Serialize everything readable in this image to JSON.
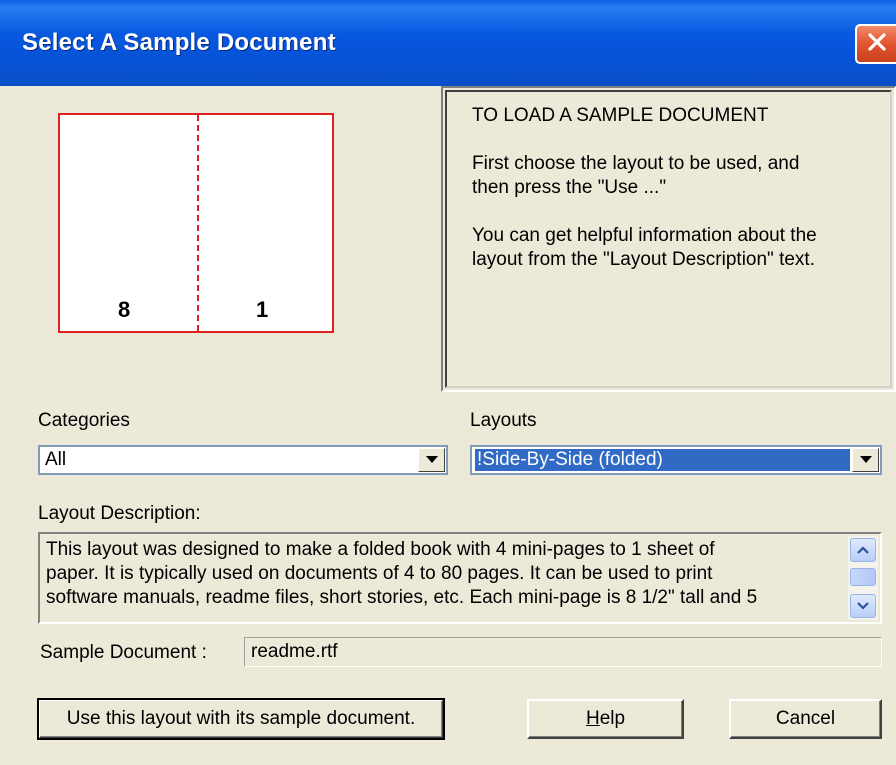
{
  "window": {
    "title": "Select A Sample Document"
  },
  "preview": {
    "left_page": "8",
    "right_page": "1"
  },
  "info": {
    "heading": "TO LOAD A SAMPLE DOCUMENT",
    "line1": "First choose the layout to be used, and",
    "line2": "then press the \"Use ...\"",
    "line3": "You can get helpful information about the",
    "line4": "layout from the \"Layout Description\" text."
  },
  "categories": {
    "label": "Categories",
    "value": "All"
  },
  "layouts": {
    "label": "Layouts",
    "value": "!Side-By-Side (folded)"
  },
  "description": {
    "label": "Layout Description:",
    "line1": "This layout was designed to make a folded book with 4 mini-pages to 1 sheet of",
    "line2": "paper. It is typically used on documents of 4 to 80 pages.  It can be used to print",
    "line3": "software manuals, readme files, short stories, etc.  Each mini-page is 8 1/2\" tall and 5"
  },
  "sample": {
    "label": "Sample Document :",
    "value": "readme.rtf"
  },
  "buttons": {
    "use": "Use this layout with its sample document.",
    "help_first": "H",
    "help_rest": "elp",
    "cancel": "Cancel"
  },
  "colors": {
    "titlebar": "#0652d6",
    "preview_border": "#e02020",
    "selection": "#316ac5",
    "dialog_bg": "#ece9d8"
  }
}
